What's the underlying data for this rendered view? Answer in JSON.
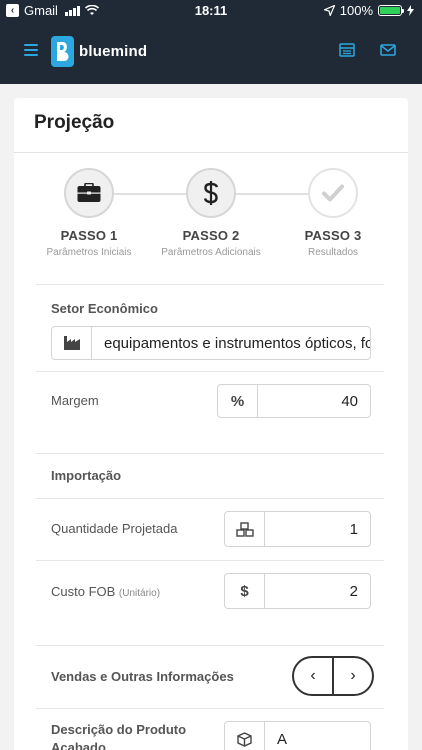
{
  "status": {
    "back_app": "Gmail",
    "time": "18:11",
    "battery": "100%",
    "battery_level": 1.0
  },
  "header": {
    "app_name": "bluemind",
    "brand_color": "#2ca7e0",
    "icons": [
      "menu-icon",
      "list-icon",
      "mail-icon"
    ]
  },
  "page": {
    "title": "Projeção"
  },
  "steps": [
    {
      "title": "PASSO 1",
      "subtitle": "Parâmetros Iniciais",
      "icon": "briefcase-icon"
    },
    {
      "title": "PASSO 2",
      "subtitle": "Parâmetros Adicionais",
      "icon": "dollar-icon"
    },
    {
      "title": "PASSO 3",
      "subtitle": "Resultados",
      "icon": "check-icon"
    }
  ],
  "form": {
    "setor": {
      "label": "Setor Econômico",
      "value": "equipamentos e instrumentos ópticos, fc",
      "icon": "industry-icon"
    },
    "margem": {
      "label": "Margem",
      "addon": "%",
      "value": "40"
    },
    "importacao": {
      "heading": "Importação"
    },
    "quantidade": {
      "label": "Quantidade Projetada",
      "value": "1",
      "icon": "boxes-icon"
    },
    "custo": {
      "label": "Custo FOB",
      "note": "(Unitário)",
      "addon": "$",
      "value": "2"
    },
    "vendas": {
      "heading": "Vendas e Outras Informações",
      "prev": "‹",
      "next": "›"
    },
    "descricao": {
      "label_line1": "Descrição do Produto",
      "label_line2": "Acabado",
      "value": "A",
      "icon": "box-icon"
    }
  }
}
